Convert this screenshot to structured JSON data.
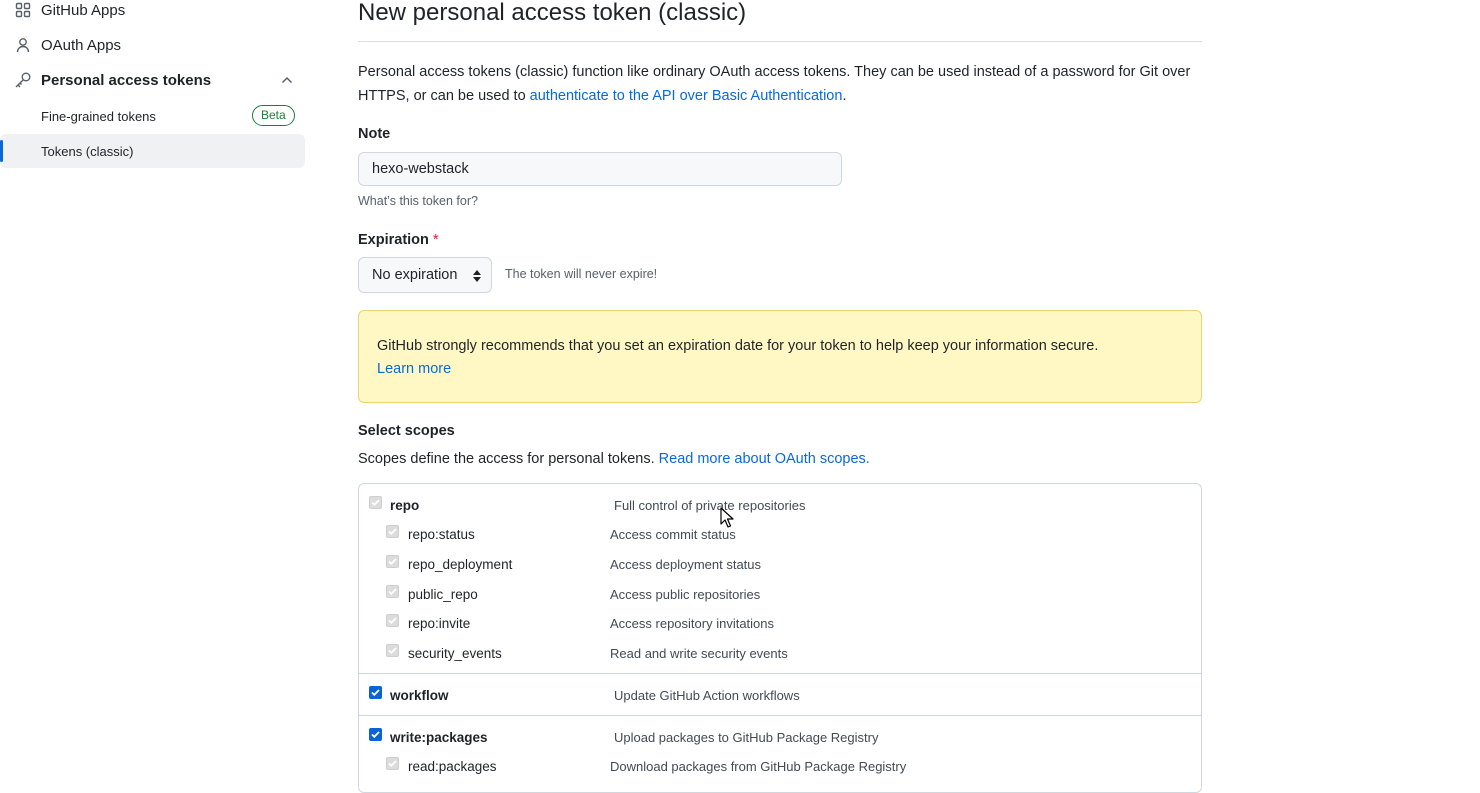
{
  "sidebar": {
    "items": [
      {
        "label": "GitHub Apps",
        "icon": "apps-grid-icon"
      },
      {
        "label": "OAuth Apps",
        "icon": "person-icon"
      },
      {
        "label": "Personal access tokens",
        "icon": "key-icon",
        "expanded": true
      }
    ],
    "sub_items": [
      {
        "label": "Fine-grained tokens",
        "badge": "Beta"
      },
      {
        "label": "Tokens (classic)",
        "active": true
      }
    ]
  },
  "main": {
    "title": "New personal access token (classic)",
    "description_prefix": "Personal access tokens (classic) function like ordinary OAuth access tokens. They can be used instead of a password for Git over HTTPS, or can be used to ",
    "description_link": "authenticate to the API over Basic Authentication",
    "description_suffix": ".",
    "note": {
      "label": "Note",
      "value": "hexo-webstack",
      "hint": "What’s this token for?"
    },
    "expiration": {
      "label": "Expiration",
      "required_mark": "*",
      "selected": "No expiration",
      "note": "The token will never expire!"
    },
    "warning": {
      "text": "GitHub strongly recommends that you set an expiration date for your token to help keep your information secure.",
      "link": "Learn more"
    },
    "scopes": {
      "label": "Select scopes",
      "description": "Scopes define the access for personal tokens.",
      "link": "Read more about OAuth scopes.",
      "groups": [
        {
          "name": "repo",
          "desc": "Full control of private repositories",
          "checked": true,
          "disabled": true,
          "children": [
            {
              "name": "repo:status",
              "desc": "Access commit status"
            },
            {
              "name": "repo_deployment",
              "desc": "Access deployment status"
            },
            {
              "name": "public_repo",
              "desc": "Access public repositories"
            },
            {
              "name": "repo:invite",
              "desc": "Access repository invitations"
            },
            {
              "name": "security_events",
              "desc": "Read and write security events"
            }
          ]
        },
        {
          "name": "workflow",
          "desc": "Update GitHub Action workflows",
          "checked": true,
          "disabled": false,
          "children": []
        },
        {
          "name": "write:packages",
          "desc": "Upload packages to GitHub Package Registry",
          "checked": true,
          "disabled": false,
          "children": [
            {
              "name": "read:packages",
              "desc": "Download packages from GitHub Package Registry"
            }
          ]
        }
      ]
    }
  },
  "colors": {
    "accent": "#0969da",
    "success": "#1a7f37",
    "danger": "#cf222e",
    "warning_bg": "#fff8c5"
  }
}
